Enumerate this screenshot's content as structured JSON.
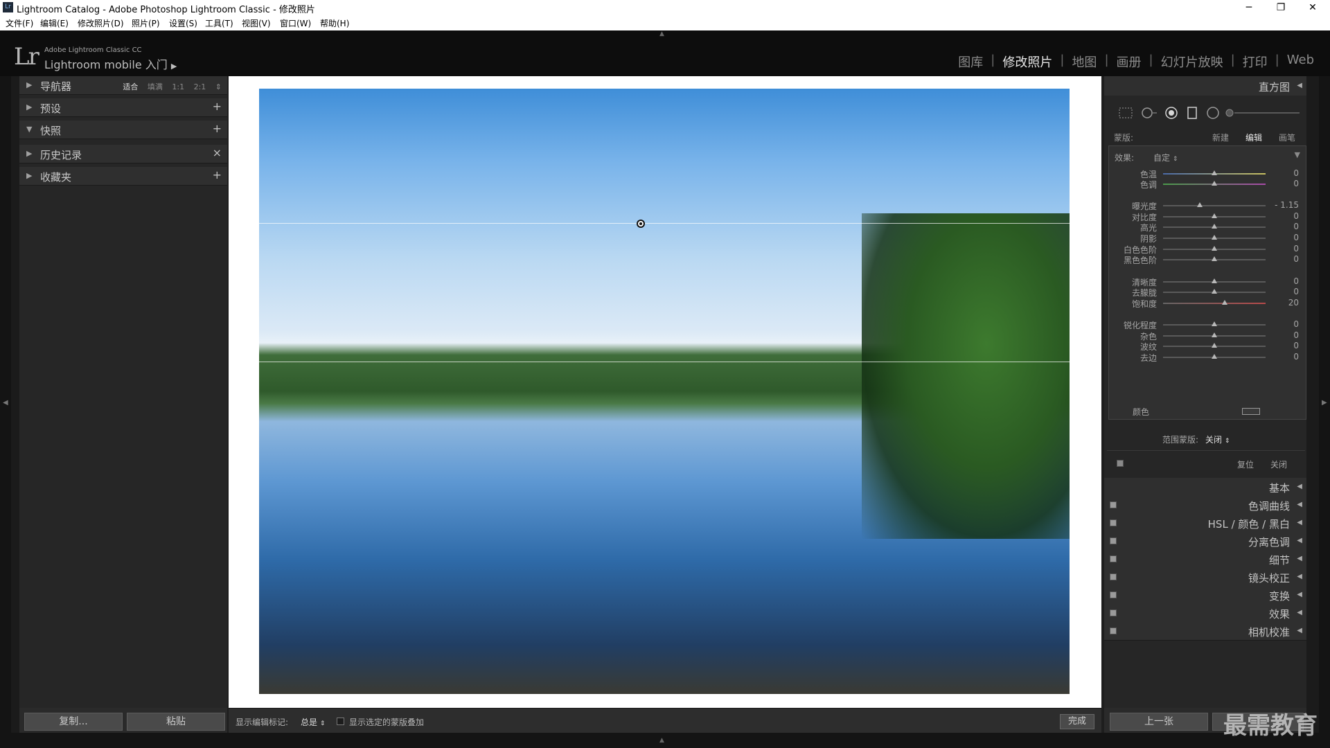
{
  "window": {
    "title": "Lightroom Catalog - Adobe Photoshop Lightroom Classic - 修改照片",
    "controls": {
      "minimize": "─",
      "restore": "❐",
      "close": "✕"
    }
  },
  "menu": [
    "文件(F)",
    "编辑(E)",
    "修改照片(D)",
    "照片(P)",
    "设置(S)",
    "工具(T)",
    "视图(V)",
    "窗口(W)",
    "帮助(H)"
  ],
  "header": {
    "logo": "Lr",
    "product_line": "Adobe Lightroom Classic CC",
    "mobile_label": "Lightroom mobile 入门",
    "modules": [
      "图库",
      "修改照片",
      "地图",
      "画册",
      "幻灯片放映",
      "打印",
      "Web"
    ],
    "active_module": "修改照片"
  },
  "left_panel": {
    "navigator": {
      "label": "导航器",
      "options": [
        "适合",
        "填满",
        "1:1",
        "2:1"
      ],
      "active_option": "适合"
    },
    "sections": [
      {
        "label": "预设",
        "action": "+"
      },
      {
        "label": "快照",
        "action": "+"
      },
      {
        "label": "历史记录",
        "action": "×"
      },
      {
        "label": "收藏夹",
        "action": "+"
      }
    ],
    "footer": {
      "copy": "复制...",
      "paste": "粘贴"
    }
  },
  "toolbar": {
    "show_edit_pins_label": "显示编辑标记:",
    "show_edit_pins_value": "总是",
    "overlay_label": "显示选定的蒙版叠加",
    "done": "完成"
  },
  "right_panel": {
    "histogram": "直方图",
    "mask": {
      "label": "蒙版:",
      "new": "新建",
      "edit": "编辑",
      "brush": "画笔",
      "active": "编辑"
    },
    "effect": {
      "label": "效果:",
      "value": "自定"
    },
    "sliders": [
      {
        "label": "色温",
        "value": "0",
        "pos": 0.5
      },
      {
        "label": "色调",
        "value": "0",
        "pos": 0.5
      },
      {
        "label": "曝光度",
        "value": "- 1.15",
        "pos": 0.36
      },
      {
        "label": "对比度",
        "value": "0",
        "pos": 0.5
      },
      {
        "label": "高光",
        "value": "0",
        "pos": 0.5
      },
      {
        "label": "阴影",
        "value": "0",
        "pos": 0.5
      },
      {
        "label": "白色色阶",
        "value": "0",
        "pos": 0.5
      },
      {
        "label": "黑色色阶",
        "value": "0",
        "pos": 0.5
      },
      {
        "label": "清晰度",
        "value": "0",
        "pos": 0.5
      },
      {
        "label": "去朦胧",
        "value": "0",
        "pos": 0.5
      },
      {
        "label": "饱和度",
        "value": "20",
        "pos": 0.6
      },
      {
        "label": "锐化程度",
        "value": "0",
        "pos": 0.5
      },
      {
        "label": "杂色",
        "value": "0",
        "pos": 0.5
      },
      {
        "label": "波纹",
        "value": "0",
        "pos": 0.5
      },
      {
        "label": "去边",
        "value": "0",
        "pos": 0.5
      }
    ],
    "color_label": "颜色",
    "range_mask": {
      "label": "范围蒙版:",
      "value": "关闭"
    },
    "reset": "复位",
    "close": "关闭",
    "panels": [
      "基本",
      "色调曲线",
      "HSL / 颜色 / 黑白",
      "分离色调",
      "细节",
      "镜头校正",
      "变换",
      "效果",
      "相机校准"
    ],
    "footer": {
      "previous": "上一张"
    }
  },
  "watermark": "最需教育"
}
